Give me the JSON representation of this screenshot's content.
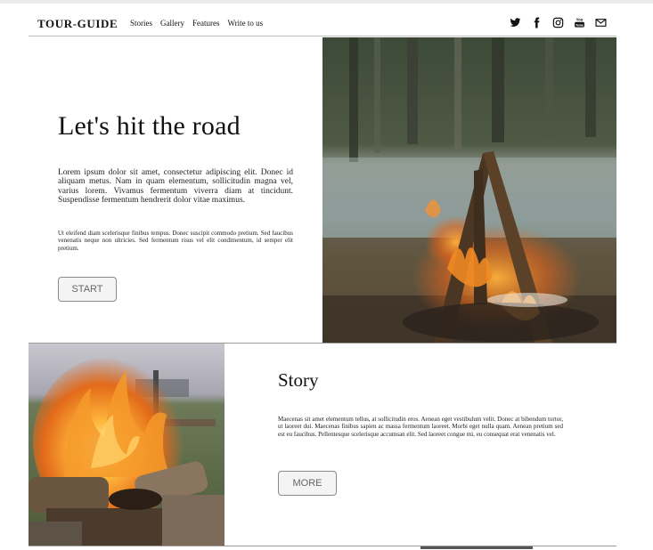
{
  "header": {
    "brand": "TOUR-GUIDE",
    "nav": [
      "Stories",
      "Gallery",
      "Features",
      "Write to us"
    ],
    "social_icons": [
      "twitter-icon",
      "facebook-icon",
      "instagram-icon",
      "youtube-icon",
      "mail-icon"
    ]
  },
  "hero": {
    "title": "Let's hit the road",
    "paragraph1": "Lorem ipsum dolor sit amet, consectetur adipiscing elit. Donec id aliquam metus. Nam in quam elementum, sollicitudin magna vel, varius lorem. Vivamus fermentum viverra diam at tincidunt. Suspendisse fermentum hendrerit dolor vitae maximus.",
    "paragraph2": "Ut eleifend diam scelerisque finibus tempus. Donec suscipit commodo pretium. Sed faucibus venenatis neque non ultricies. Sed fermentum risus vel elit condimentum, id semper elit pretium.",
    "button": "START",
    "image": "campfire-by-river-photo"
  },
  "story": {
    "title": "Story",
    "paragraph": "Maecenas sit amet elementum tellus, at sollicitudin eros. Aenean eget vestibulum velit. Donec at bibendum tortor, ut laoreet dui. Maecenas finibus sapien ac massa fermentum laoreet. Morbi eget nulla quam. Aenean pretium sed est eu faucibus. Pellentesque scelerisque accumsan elit. Sed laoreet congue mi, eu consequat erat venenatis vel.",
    "button": "MORE",
    "image": "burning-logs-photo"
  },
  "colors": {
    "text": "#111111",
    "button_border": "#8a8a8a",
    "button_text": "#666666",
    "divider": "#9a9a9a"
  }
}
